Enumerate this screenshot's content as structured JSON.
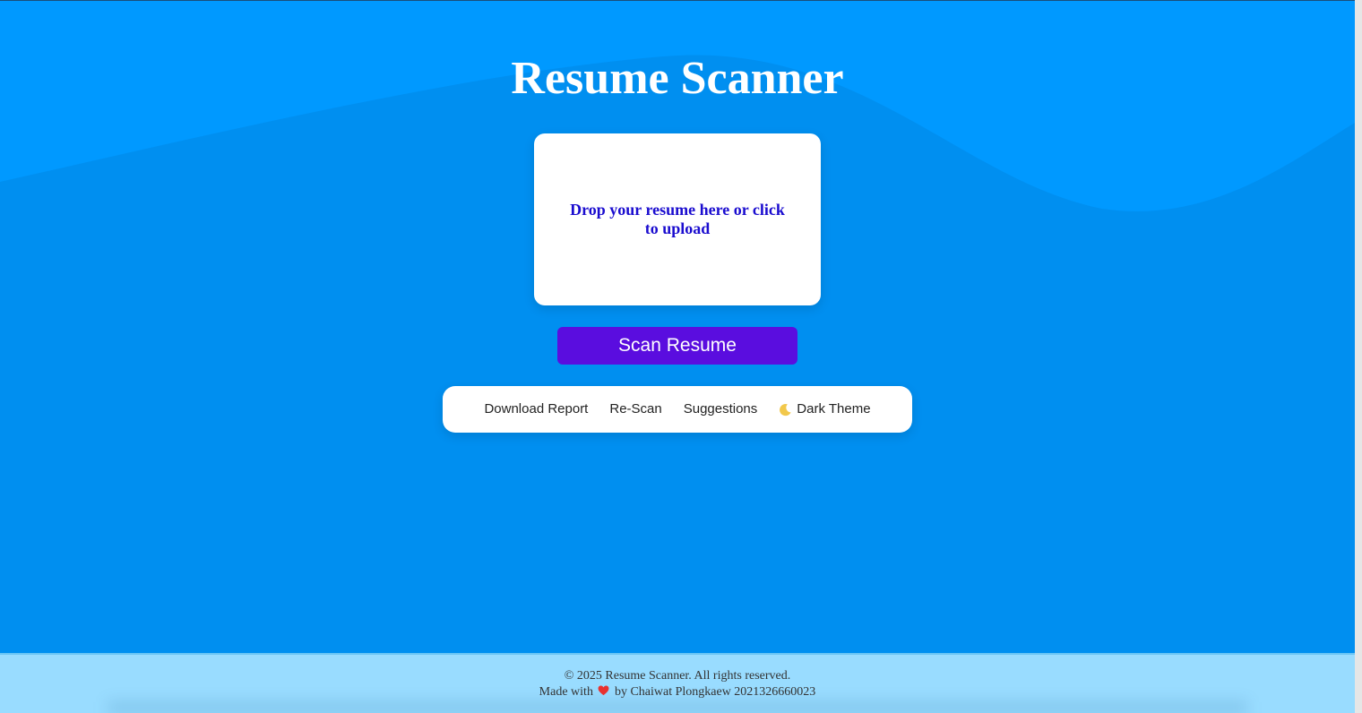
{
  "app": {
    "title": "Resume Scanner"
  },
  "upload": {
    "prompt": "Drop your resume here or click to upload"
  },
  "scan_button": {
    "label": "Scan Resume"
  },
  "actions": [
    {
      "label": "Download Report"
    },
    {
      "label": "Re-Scan"
    },
    {
      "label": "Suggestions"
    },
    {
      "label": "Dark Theme",
      "icon": "moon-icon"
    }
  ],
  "footer": {
    "copyright": "© 2025 Resume Scanner. All rights reserved.",
    "made_with_prefix": "Made with",
    "made_with_icon": "heart-icon",
    "made_with_suffix": "by Chaiwat Plongkaew 2021326660023"
  },
  "colors": {
    "background": "#0099ff",
    "wave": "#008ff0",
    "footer": "#99dcff",
    "scan_button": "#5a0ddf",
    "upload_text": "#1a0ccf"
  }
}
